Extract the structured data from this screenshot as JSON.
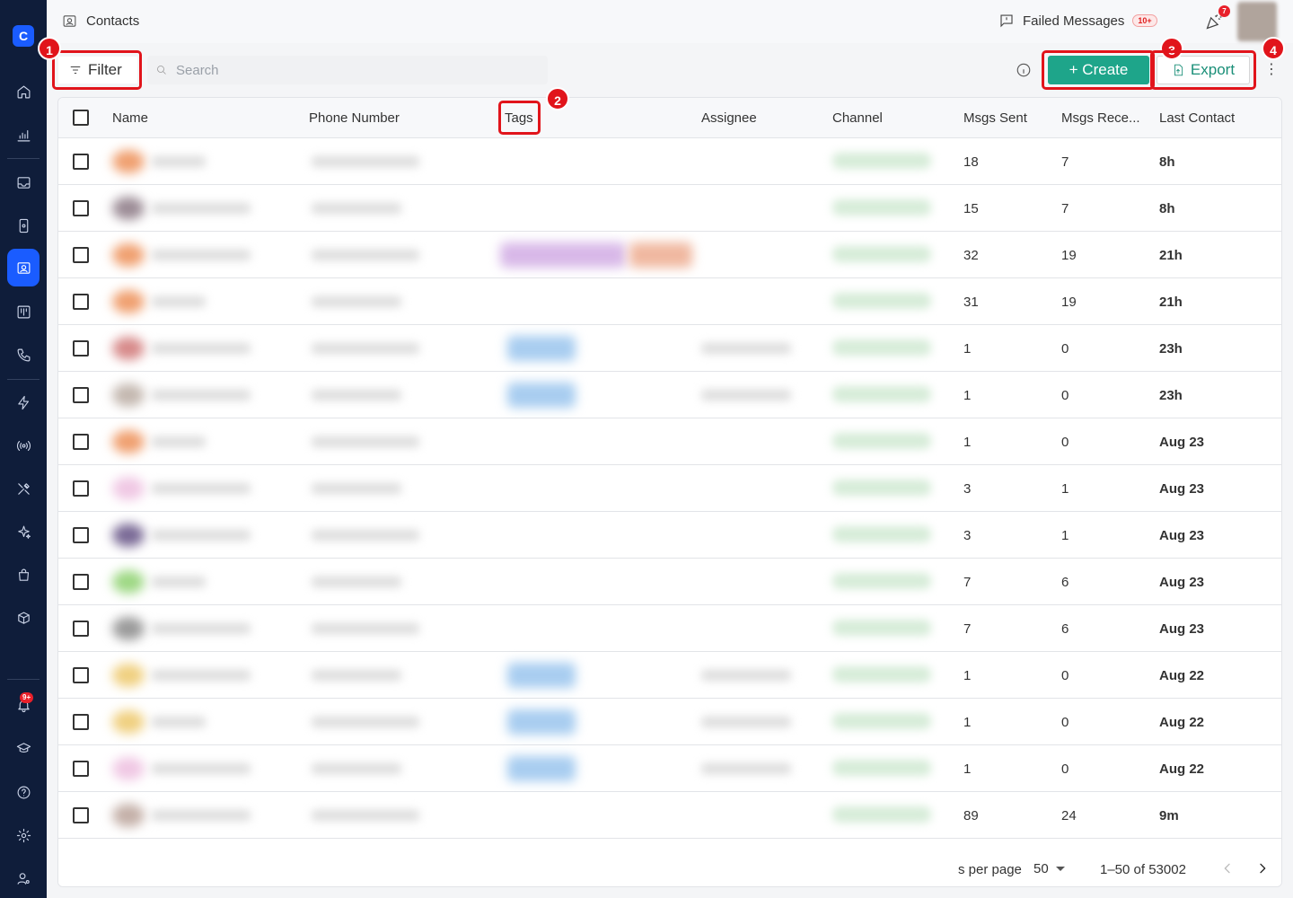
{
  "topbar": {
    "page_title": "Contacts",
    "failed_messages_label": "Failed Messages",
    "failed_messages_badge": "10+",
    "notification_badge": "7"
  },
  "sidebar": {
    "notification_badge": "9+",
    "active_item": "contacts"
  },
  "toolbar": {
    "filter_label": "Filter",
    "search_placeholder": "Search",
    "create_label": "+ Create",
    "export_label": "Export",
    "more_label": "⋮"
  },
  "annotations": [
    "1",
    "2",
    "3",
    "4"
  ],
  "table": {
    "columns": [
      "Name",
      "Phone Number",
      "Tags",
      "Assignee",
      "Channel",
      "Msgs Sent",
      "Msgs Rece...",
      "Last Contact"
    ],
    "rows": [
      {
        "sent": "18",
        "received": "7",
        "last": "8h"
      },
      {
        "sent": "15",
        "received": "7",
        "last": "8h"
      },
      {
        "sent": "32",
        "received": "19",
        "last": "21h"
      },
      {
        "sent": "31",
        "received": "19",
        "last": "21h"
      },
      {
        "sent": "1",
        "received": "0",
        "last": "23h"
      },
      {
        "sent": "1",
        "received": "0",
        "last": "23h"
      },
      {
        "sent": "1",
        "received": "0",
        "last": "Aug 23"
      },
      {
        "sent": "3",
        "received": "1",
        "last": "Aug 23"
      },
      {
        "sent": "3",
        "received": "1",
        "last": "Aug 23"
      },
      {
        "sent": "7",
        "received": "6",
        "last": "Aug 23"
      },
      {
        "sent": "7",
        "received": "6",
        "last": "Aug 23"
      },
      {
        "sent": "1",
        "received": "0",
        "last": "Aug 22"
      },
      {
        "sent": "1",
        "received": "0",
        "last": "Aug 22"
      },
      {
        "sent": "1",
        "received": "0",
        "last": "Aug 22"
      },
      {
        "sent": "89",
        "received": "24",
        "last": "9m"
      }
    ]
  },
  "footer": {
    "rows_per_page_label": "s per page",
    "rows_per_page_value": "50",
    "range": "1–50 of 53002"
  },
  "colors": {
    "sidebar_bg": "#0f1d3a",
    "accent_blue": "#1a5cff",
    "create_green": "#1ea58a",
    "annotation_red": "#e1141b"
  }
}
